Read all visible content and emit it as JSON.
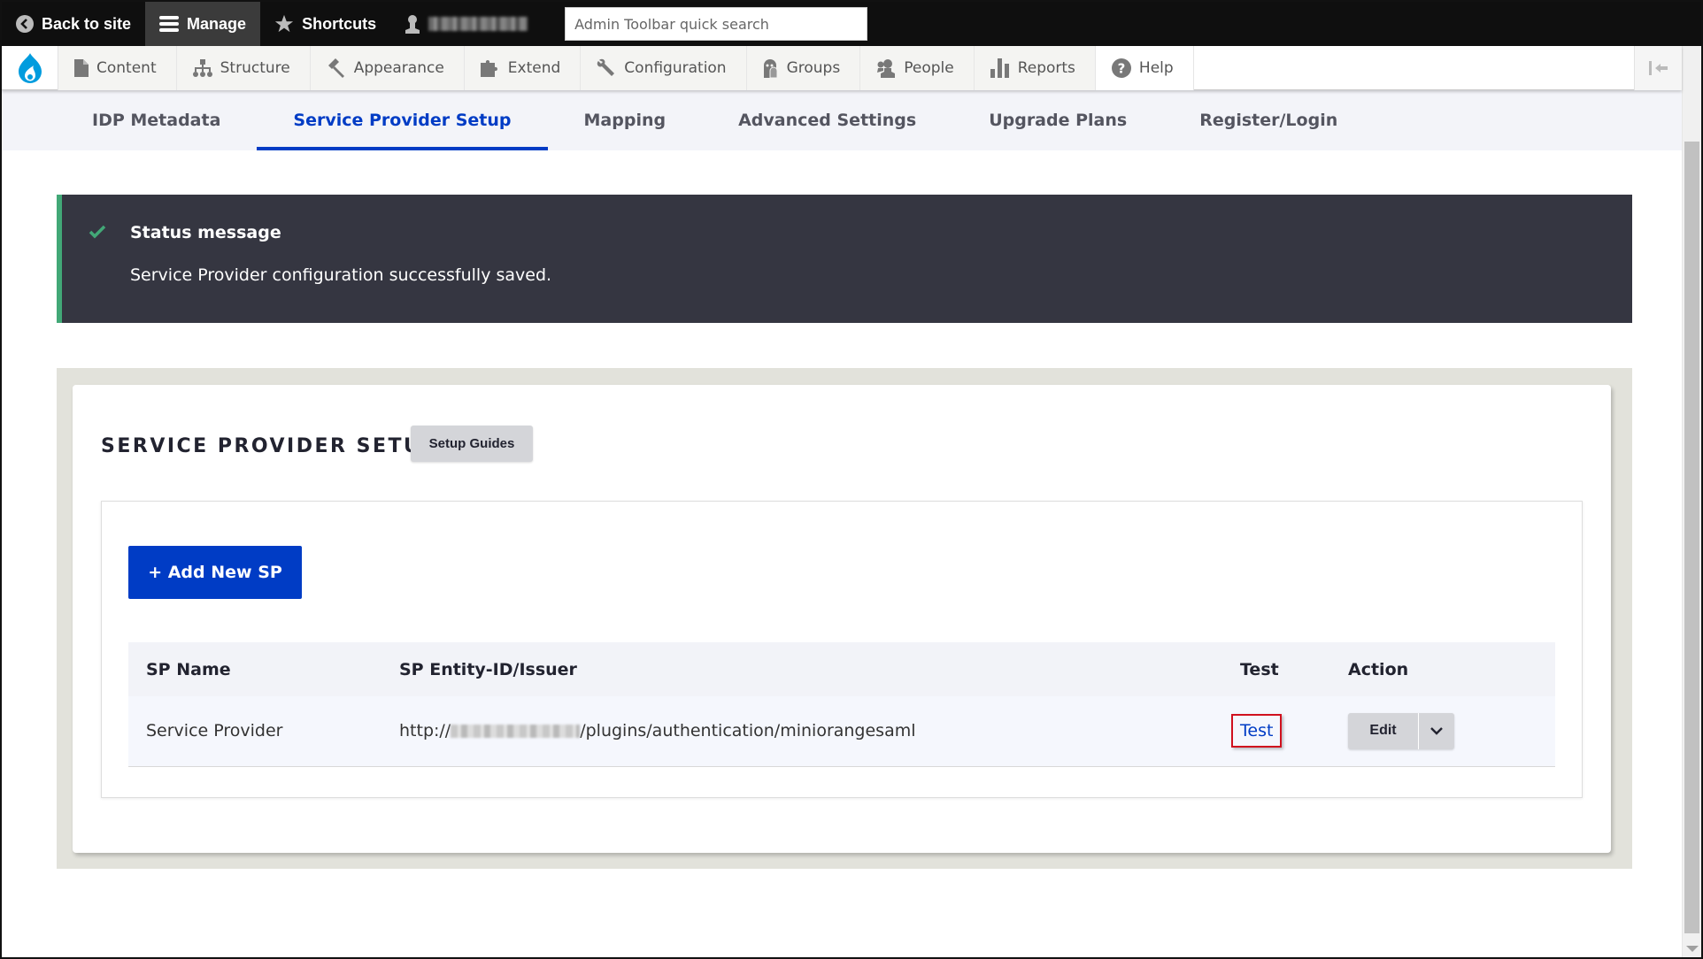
{
  "toolbar": {
    "back_label": "Back to site",
    "manage_label": "Manage",
    "shortcuts_label": "Shortcuts",
    "user_label": "",
    "search_placeholder": "Admin Toolbar quick search"
  },
  "menu": {
    "items": [
      {
        "label": "Content",
        "icon": "file-icon"
      },
      {
        "label": "Structure",
        "icon": "sitemap-icon"
      },
      {
        "label": "Appearance",
        "icon": "paintbrush-icon"
      },
      {
        "label": "Extend",
        "icon": "puzzle-icon"
      },
      {
        "label": "Configuration",
        "icon": "wrench-icon"
      },
      {
        "label": "Groups",
        "icon": "groups-icon"
      },
      {
        "label": "People",
        "icon": "people-icon"
      },
      {
        "label": "Reports",
        "icon": "bar-chart-icon"
      },
      {
        "label": "Help",
        "icon": "question-icon"
      }
    ]
  },
  "tabs": [
    {
      "label": "IDP Metadata",
      "active": false
    },
    {
      "label": "Service Provider Setup",
      "active": true
    },
    {
      "label": "Mapping",
      "active": false
    },
    {
      "label": "Advanced Settings",
      "active": false
    },
    {
      "label": "Upgrade Plans",
      "active": false
    },
    {
      "label": "Register/Login",
      "active": false
    }
  ],
  "status": {
    "title": "Status message",
    "text": "Service Provider configuration successfully saved.",
    "accent": "#42a877"
  },
  "section": {
    "heading": "SERVICE PROVIDER SETUP",
    "guide_button": "Setup Guides",
    "add_button": "+ Add New SP"
  },
  "table": {
    "headers": [
      "SP Name",
      "SP Entity-ID/Issuer",
      "Test",
      "Action"
    ],
    "rows": [
      {
        "name": "Service Provider",
        "entity_prefix": "http://",
        "entity_suffix": "/plugins/authentication/miniorangesaml",
        "test_label": "Test",
        "action_label": "Edit"
      }
    ]
  },
  "colors": {
    "primary": "#003cc5",
    "status_bg": "#353641",
    "highlight_border": "#d0101e"
  }
}
